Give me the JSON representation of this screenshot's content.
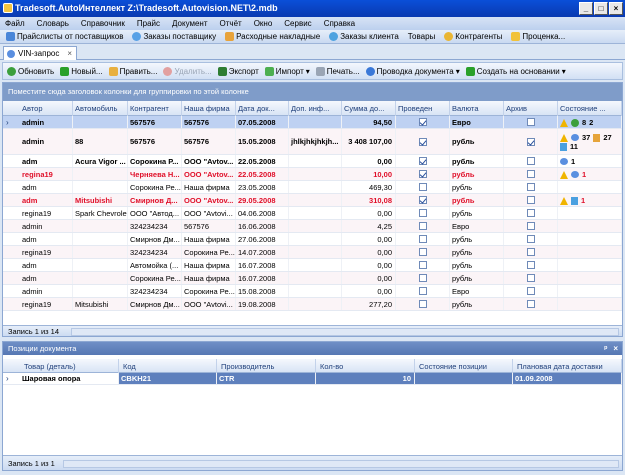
{
  "window": {
    "title": "Tradesoft.AutoИнтеллект  Z:\\Tradesoft.Autovision.NET\\2.mdb",
    "buttons": [
      "_",
      "□",
      "×"
    ]
  },
  "menu": [
    "Файл",
    "Словарь",
    "Справочник",
    "Прайс",
    "Документ",
    "Отчёт",
    "Окно",
    "Сервис",
    "Справка"
  ],
  "nav": [
    "Прайслисты от поставщиков",
    "Заказы поставщику",
    "Расходные накладные",
    "Заказы клиента",
    "Товары",
    "Контрагенты",
    "Проценка..."
  ],
  "doc_tab": {
    "label": "VIN-запрос",
    "close": "×"
  },
  "toolbar": [
    "Обновить",
    "Новый...",
    "Править...",
    "Удалить...",
    "Экспорт",
    "Импорт",
    "Печать...",
    "Проводка документа",
    "Создать на основании"
  ],
  "group_hint": "Поместите сюда заголовок колонки для группировки по этой колонке",
  "columns": [
    "Автор",
    "Автомобиль",
    "Контрагент",
    "Наша фирма",
    "Дата док...",
    "Доп. инф...",
    "Сумма до...",
    "Проведен",
    "Валюта",
    "Архив",
    "Состояние ..."
  ],
  "rows": [
    {
      "author": "admin",
      "car": "",
      "agent": "567576",
      "firm": "567576",
      "date": "07.05.2008",
      "info": "",
      "sum": "94,50",
      "posted": true,
      "currency": "Евро",
      "archive": false,
      "bold": true,
      "red": false,
      "selected": true,
      "state": [
        {
          "i": "warn"
        },
        {
          "i": "recyc"
        },
        {
          "t": "8"
        },
        {
          "t": "2"
        }
      ]
    },
    {
      "author": "admin",
      "car": "88",
      "agent": "567576",
      "firm": "567576",
      "date": "15.05.2008",
      "info": "jhlkjhkjhkjh...",
      "sum": "3 408 107,00",
      "posted": true,
      "currency": "рубль",
      "archive": true,
      "bold": true,
      "red": false,
      "selected": false,
      "state": [
        {
          "i": "warn"
        },
        {
          "i": "bubble"
        },
        {
          "t": "37"
        },
        {
          "i": "doc"
        },
        {
          "t": "27"
        },
        {
          "i": "pdoc"
        },
        {
          "t": "11"
        }
      ]
    },
    {
      "author": "adm",
      "car": "Acura Vigor ...",
      "agent": "Сорокина Р...",
      "firm": "ООО \"Avtov...",
      "date": "22.05.2008",
      "info": "",
      "sum": "0,00",
      "posted": true,
      "currency": "рубль",
      "archive": false,
      "bold": true,
      "red": false,
      "selected": false,
      "state": [
        {
          "i": "bubble"
        },
        {
          "t": "1"
        }
      ]
    },
    {
      "author": "regina19",
      "car": "",
      "agent": "Черняева Н...",
      "firm": "ООО \"Avtov...",
      "date": "22.05.2008",
      "info": "",
      "sum": "10,00",
      "posted": true,
      "currency": "рубль",
      "archive": false,
      "bold": true,
      "red": true,
      "selected": false,
      "state": [
        {
          "i": "warn"
        },
        {
          "i": "bubble"
        },
        {
          "t": "1"
        }
      ]
    },
    {
      "author": "adm",
      "car": "",
      "agent": "Сорокина Ре...",
      "firm": "Наша фирма",
      "date": "23.05.2008",
      "info": "",
      "sum": "469,30",
      "posted": false,
      "currency": "рубль",
      "archive": false,
      "bold": false,
      "red": false,
      "selected": false,
      "state": []
    },
    {
      "author": "adm",
      "car": "Mitsubishi",
      "agent": "Смирнов Д...",
      "firm": "ООО \"Avtov...",
      "date": "29.05.2008",
      "info": "",
      "sum": "310,08",
      "posted": true,
      "currency": "рубль",
      "archive": false,
      "bold": true,
      "red": true,
      "selected": false,
      "state": [
        {
          "i": "warn"
        },
        {
          "i": "pdoc"
        },
        {
          "t": "1"
        }
      ]
    },
    {
      "author": "regina19",
      "car": "Spark Chevrolet",
      "agent": "ООО \"Автод...",
      "firm": "ООО \"Avtovi...",
      "date": "04.06.2008",
      "info": "",
      "sum": "0,00",
      "posted": false,
      "currency": "рубль",
      "archive": false,
      "bold": false,
      "red": false,
      "selected": false,
      "state": []
    },
    {
      "author": "admin",
      "car": "",
      "agent": "324234234",
      "firm": "567576",
      "date": "16.06.2008",
      "info": "",
      "sum": "4,25",
      "posted": false,
      "currency": "Евро",
      "archive": false,
      "bold": false,
      "red": false,
      "selected": false,
      "state": []
    },
    {
      "author": "adm",
      "car": "",
      "agent": "Смирнов Дм...",
      "firm": "Наша фирма",
      "date": "27.06.2008",
      "info": "",
      "sum": "0,00",
      "posted": false,
      "currency": "рубль",
      "archive": false,
      "bold": false,
      "red": false,
      "selected": false,
      "state": []
    },
    {
      "author": "regina19",
      "car": "",
      "agent": "324234234",
      "firm": "Сорокина Ре...",
      "date": "14.07.2008",
      "info": "",
      "sum": "0,00",
      "posted": false,
      "currency": "рубль",
      "archive": false,
      "bold": false,
      "red": false,
      "selected": false,
      "state": []
    },
    {
      "author": "adm",
      "car": "",
      "agent": "Автомойка (...",
      "firm": "Наша фирма",
      "date": "16.07.2008",
      "info": "",
      "sum": "0,00",
      "posted": false,
      "currency": "рубль",
      "archive": false,
      "bold": false,
      "red": false,
      "selected": false,
      "state": []
    },
    {
      "author": "adm",
      "car": "",
      "agent": "Сорокина Ре...",
      "firm": "Наша фирма",
      "date": "16.07.2008",
      "info": "",
      "sum": "0,00",
      "posted": false,
      "currency": "рубль",
      "archive": false,
      "bold": false,
      "red": false,
      "selected": false,
      "state": []
    },
    {
      "author": "admin",
      "car": "",
      "agent": "324234234",
      "firm": "Сорокина Ре...",
      "date": "15.08.2008",
      "info": "",
      "sum": "0,00",
      "posted": false,
      "currency": "Евро",
      "archive": false,
      "bold": false,
      "red": false,
      "selected": false,
      "state": []
    },
    {
      "author": "regina19",
      "car": "Mitsubishi",
      "agent": "Смирнов Дм...",
      "firm": "ООО \"Avtovi...",
      "date": "19.08.2008",
      "info": "",
      "sum": "277,20",
      "posted": false,
      "currency": "рубль",
      "archive": false,
      "bold": false,
      "red": false,
      "selected": false,
      "state": []
    }
  ],
  "grid_footer": "Запись 1 из 14",
  "bottom": {
    "title": "Позиции документа",
    "ctrls": [
      "ᵖ",
      "×"
    ],
    "columns": [
      "Товар (деталь)",
      "Код",
      "Производитель",
      "Кол-во",
      "Состояние позиции",
      "Плановая дата доставки"
    ],
    "row": {
      "item": "Шаровая опора",
      "code": "CBKH21",
      "maker": "CTR",
      "qty": "10",
      "state": "",
      "date": "01.09.2008"
    },
    "footer": "Запись 1 из 1"
  }
}
